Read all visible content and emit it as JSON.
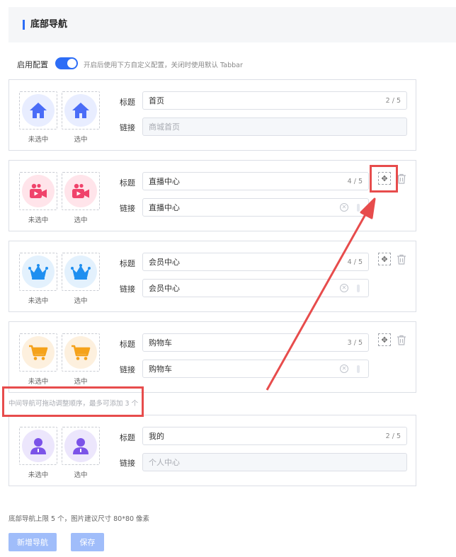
{
  "header": {
    "title": "底部导航"
  },
  "config": {
    "label": "启用配置",
    "enabled": true,
    "hint": "开启后使用下方自定义配置，关闭时使用默认 Tabbar"
  },
  "labels": {
    "unselected": "未选中",
    "selected": "选中",
    "title": "标题",
    "link": "链接"
  },
  "nav_items": [
    {
      "icon": "home-icon",
      "color": "#4a6cf7",
      "bg": "#e8edff",
      "title": "首页",
      "count": "2 / 5",
      "link": "商城首页",
      "link_disabled": true,
      "movable": false
    },
    {
      "icon": "video-camera-icon",
      "color": "#f0436b",
      "bg": "#ffe4ea",
      "title": "直播中心",
      "count": "4 / 5",
      "link": "直播中心",
      "link_disabled": false,
      "movable": true
    },
    {
      "icon": "crown-icon",
      "color": "#1f8ff0",
      "bg": "#e3f1fd",
      "title": "会员中心",
      "count": "4 / 5",
      "link": "会员中心",
      "link_disabled": false,
      "movable": true
    },
    {
      "icon": "cart-icon",
      "color": "#f5a21b",
      "bg": "#fdf0de",
      "title": "购物车",
      "count": "3 / 5",
      "link": "购物车",
      "link_disabled": false,
      "movable": true
    },
    {
      "icon": "user-icon",
      "color": "#7b53e8",
      "bg": "#ece6fc",
      "title": "我的",
      "count": "2 / 5",
      "link": "个人中心",
      "link_disabled": true,
      "movable": false
    }
  ],
  "drag_hint": "中间导航可拖动调整顺序，最多可添加 3 个",
  "footer_note": "底部导航上限 5 个，图片建议尺寸 80*80 像素",
  "buttons": {
    "add": "新增导航",
    "save": "保存"
  },
  "annotation_color": "#e74c4c"
}
